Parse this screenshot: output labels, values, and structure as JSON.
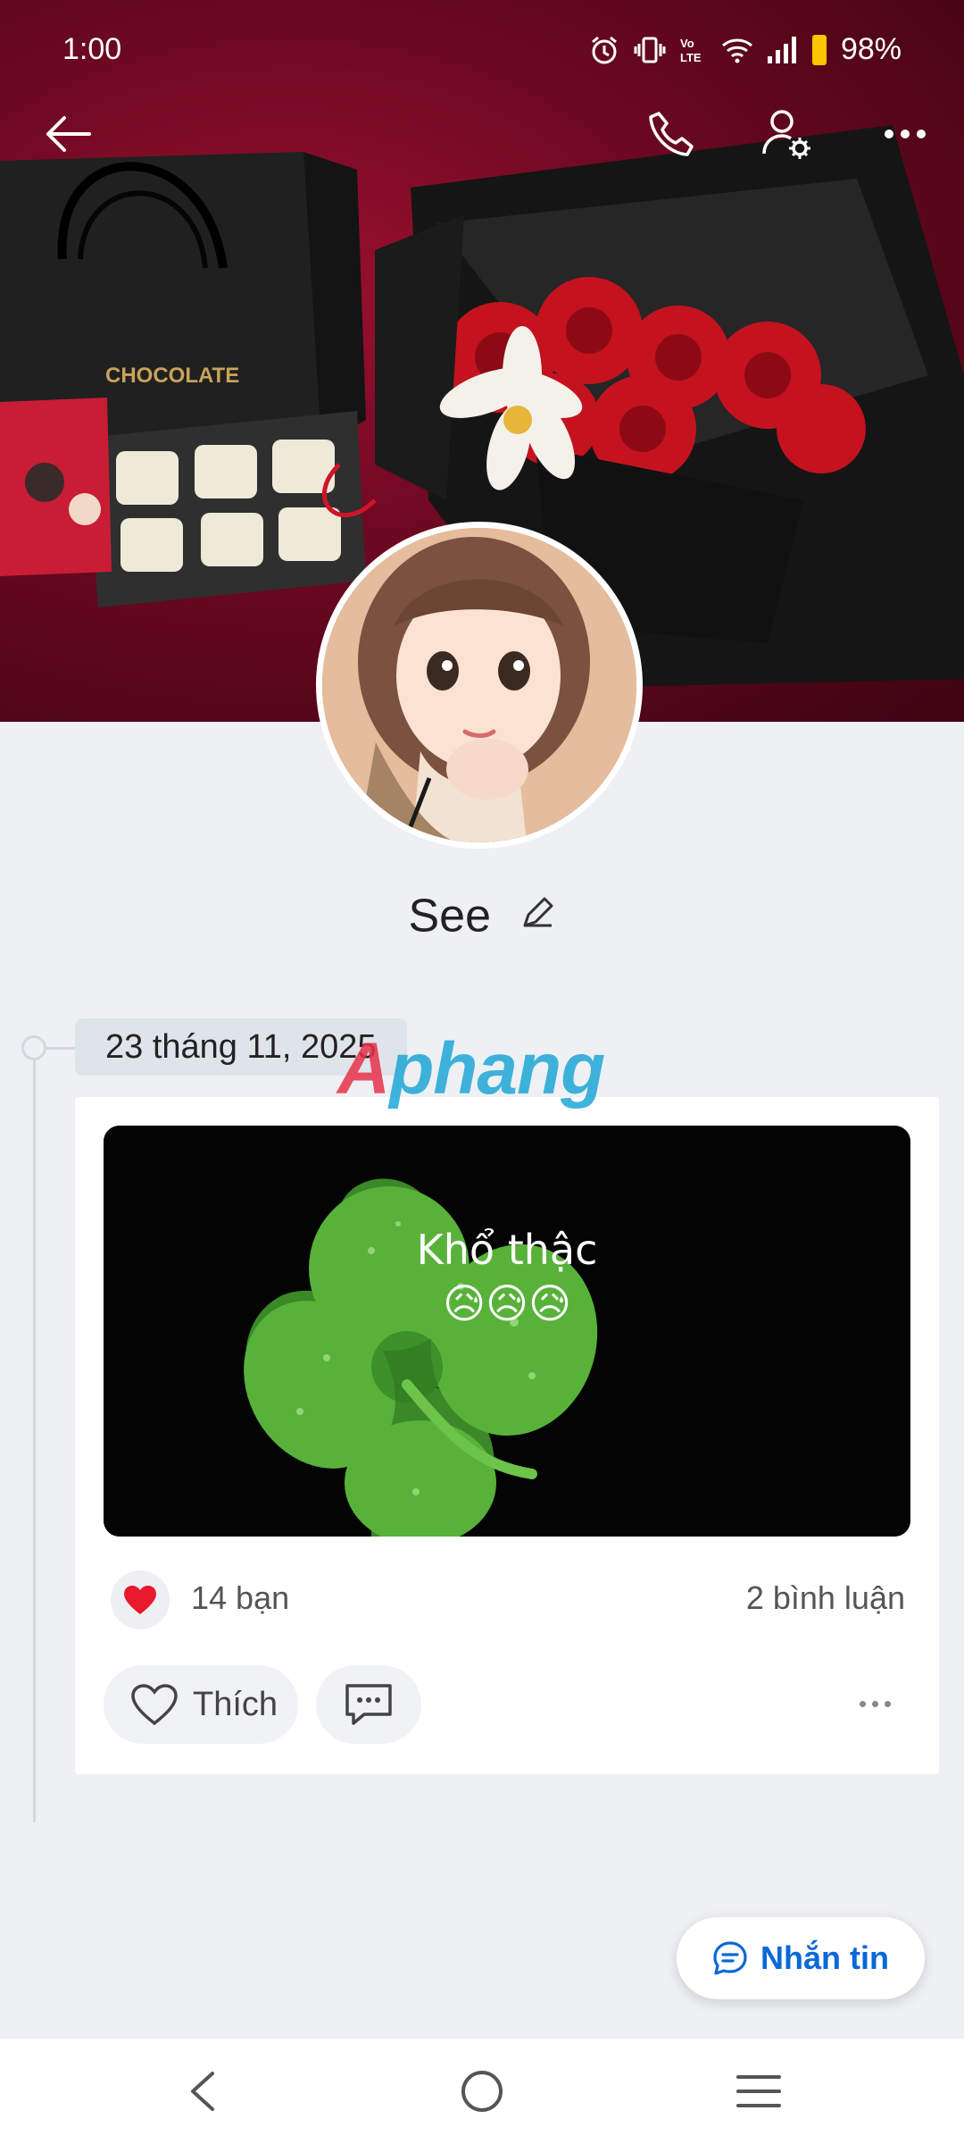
{
  "status_bar": {
    "time": "1:00",
    "battery": "98%",
    "icons": [
      "alarm-icon",
      "vibrate-icon",
      "volte-icon",
      "wifi-icon",
      "signal-icon",
      "battery-icon"
    ]
  },
  "header": {
    "icons": [
      "back-arrow-icon",
      "phone-icon",
      "profile-settings-icon",
      "more-icon"
    ]
  },
  "profile": {
    "name": "See",
    "edit_icon": "pencil-icon"
  },
  "timeline": {
    "date": "23 tháng 11, 2025",
    "watermark": {
      "part1": "A",
      "part2": "phang"
    }
  },
  "post": {
    "caption": "Khổ thậc",
    "emojis": "😥😥😥",
    "reaction_count": "14 bạn",
    "comment_count": "2 bình luận",
    "like_label": "Thích"
  },
  "message_button": {
    "label": "Nhắn tin"
  },
  "colors": {
    "accent": "#0a68d8",
    "heart": "#e8192c",
    "cover_red": "#7a0a24"
  }
}
